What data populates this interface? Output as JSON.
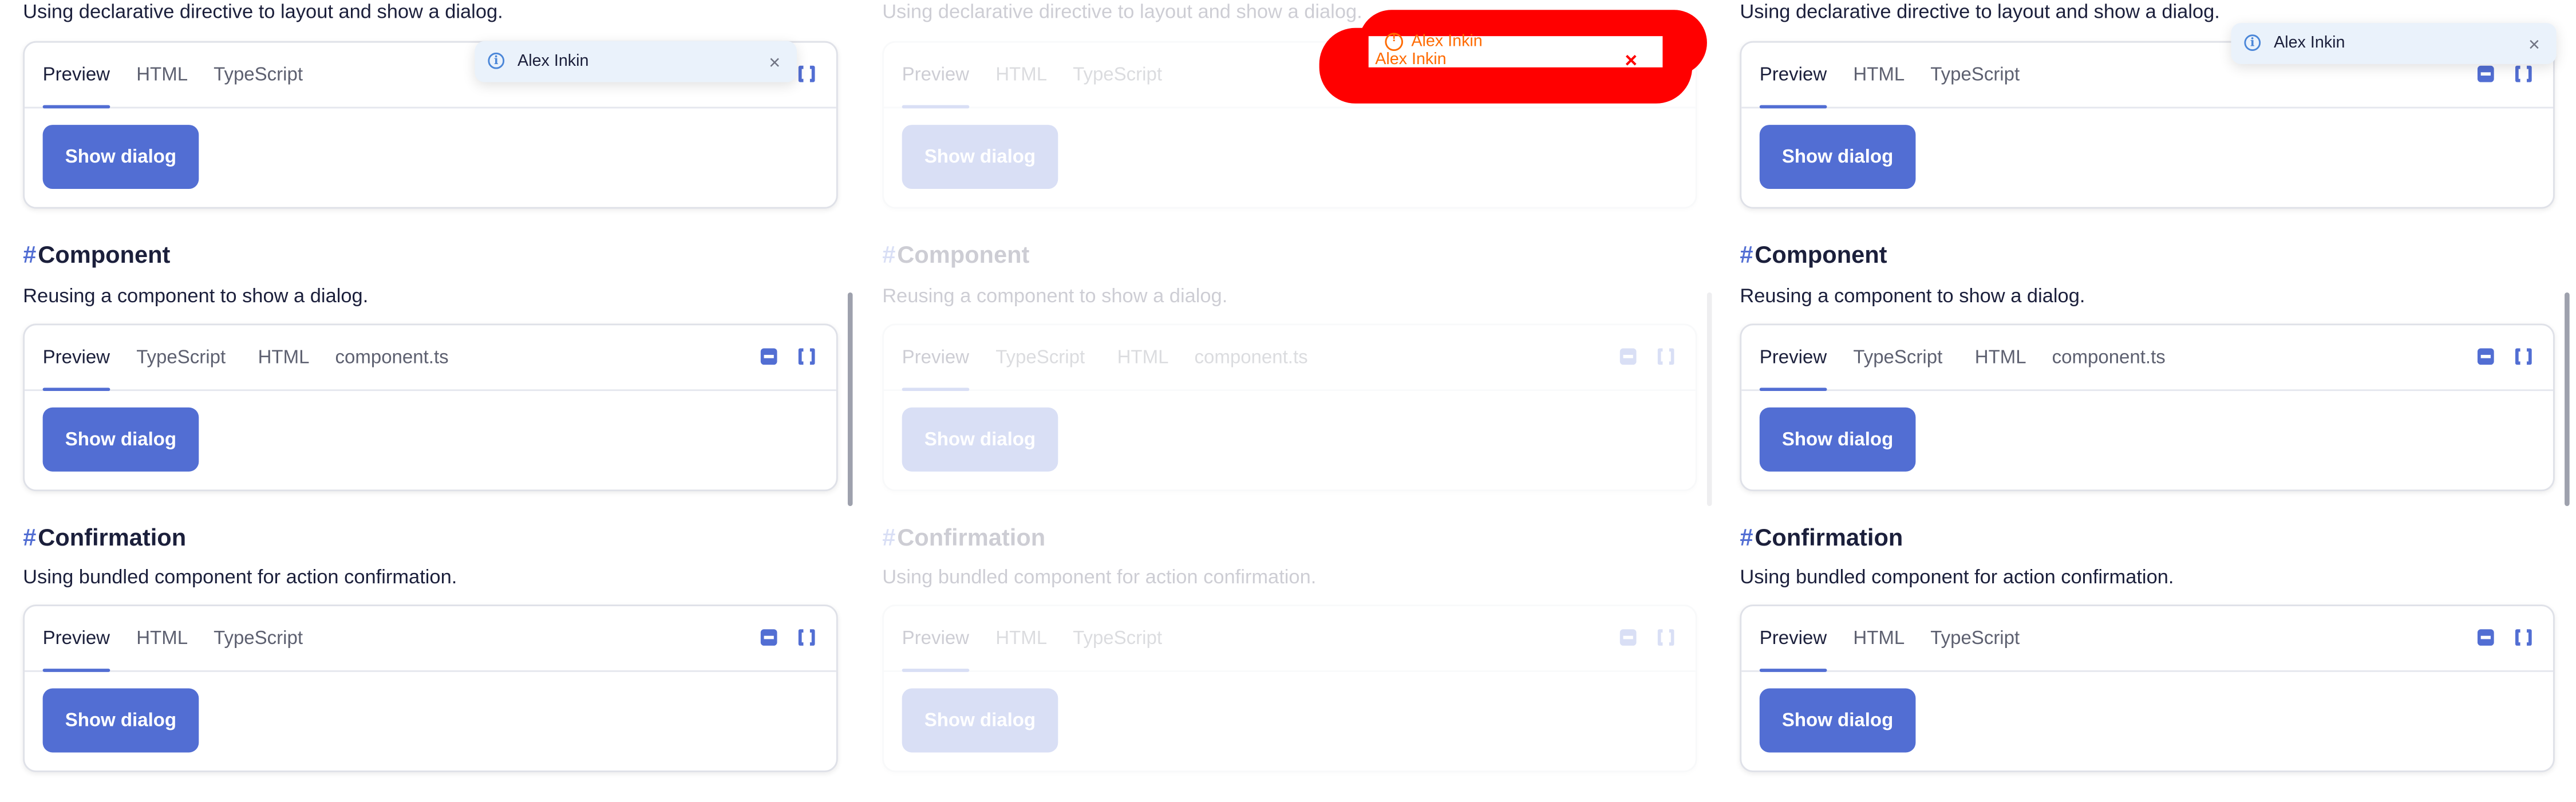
{
  "top_description": "Using declarative directive to layout and show a dialog.",
  "hash_symbol": "#",
  "tabs": {
    "preview": "Preview",
    "html": "HTML",
    "typescript": "TypeScript",
    "component_ts": "component.ts"
  },
  "button_label": "Show dialog",
  "sections": {
    "component": {
      "title": "Component",
      "description": "Reusing a component to show a dialog."
    },
    "confirmation": {
      "title": "Confirmation",
      "description": "Using bundled component for action confirmation."
    }
  },
  "notification": {
    "text": "Alex Inkin",
    "close": "×"
  },
  "colors": {
    "accent": "#526ed3",
    "notification_bg": "#eaf2fb",
    "overlay": "#ff0000"
  }
}
